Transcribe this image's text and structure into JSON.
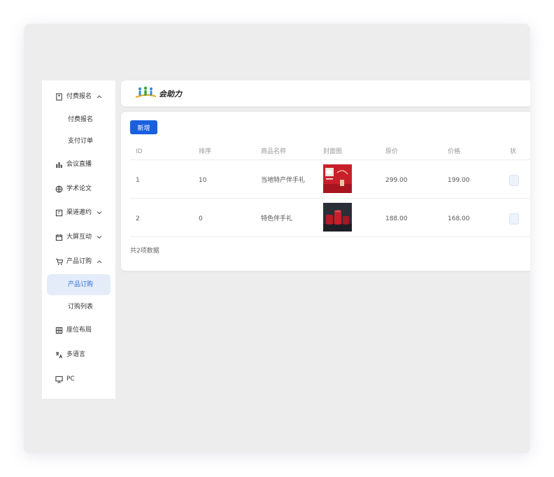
{
  "sidebar": {
    "items": [
      {
        "label": "付费报名",
        "expanded": true
      },
      {
        "label": "付费报名"
      },
      {
        "label": "支付订单"
      },
      {
        "label": "会议直播"
      },
      {
        "label": "学术论文"
      },
      {
        "label": "渠道邀约",
        "expanded": false
      },
      {
        "label": "大屏互动",
        "expanded": false
      },
      {
        "label": "产品订购",
        "expanded": true
      },
      {
        "label": "产品订购",
        "active": true
      },
      {
        "label": "订购列表"
      },
      {
        "label": "座位布局"
      },
      {
        "label": "多语言"
      },
      {
        "label": "PC"
      }
    ]
  },
  "header": {
    "logo_text": "会助力"
  },
  "toolbar": {
    "add_label": "新增"
  },
  "table": {
    "columns": [
      "ID",
      "排序",
      "商品名称",
      "封面图",
      "原价",
      "价格",
      "状"
    ],
    "rows": [
      {
        "id": "1",
        "sort": "10",
        "name": "当地特产伴手礼",
        "cover": "red-gift-product-image",
        "original_price": "299.00",
        "price": "199.00"
      },
      {
        "id": "2",
        "sort": "0",
        "name": "特色伴手礼",
        "cover": "red-teaware-product-image",
        "original_price": "188.00",
        "price": "168.00"
      }
    ],
    "footer": "共2项数据"
  },
  "colors": {
    "primary": "#1a5fe0",
    "active_bg": "#e4ecf9",
    "active_text": "#2a6dde",
    "frame_bg": "#ededed"
  }
}
